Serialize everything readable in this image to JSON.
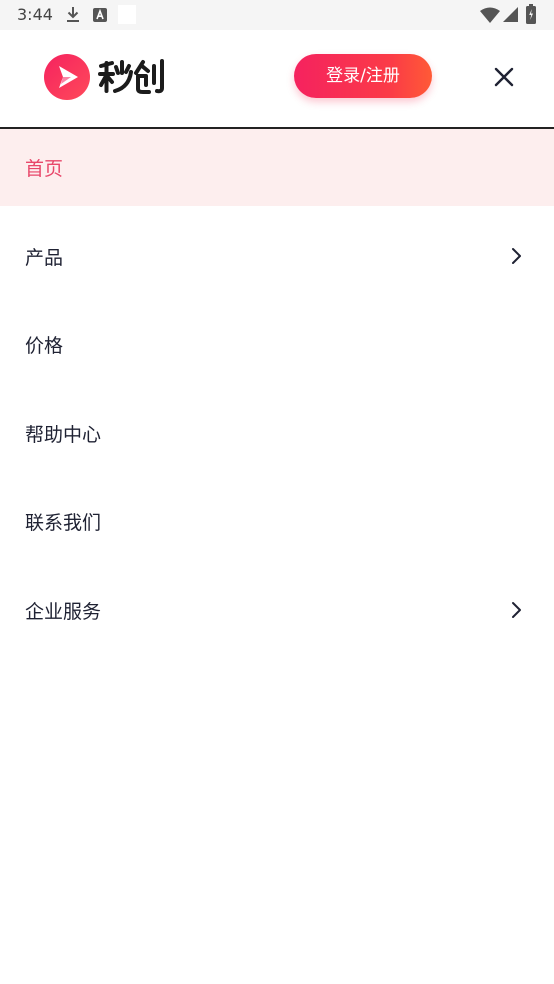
{
  "status_bar": {
    "time": "3:44",
    "icons": [
      "download-icon",
      "keyboard-a-icon",
      "blank-notification-icon",
      "wifi-icon",
      "signal-icon",
      "battery-icon"
    ]
  },
  "header": {
    "brand_name": "秒创",
    "login_label": "登录/注册",
    "brand_color": "#f12b5f",
    "button_gradient": [
      "#f5225f",
      "#ff5a36"
    ]
  },
  "menu": {
    "items": [
      {
        "label": "首页",
        "active": true,
        "has_chevron": false
      },
      {
        "label": "产品",
        "active": false,
        "has_chevron": true
      },
      {
        "label": "价格",
        "active": false,
        "has_chevron": false
      },
      {
        "label": "帮助中心",
        "active": false,
        "has_chevron": false
      },
      {
        "label": "联系我们",
        "active": false,
        "has_chevron": false
      },
      {
        "label": "企业服务",
        "active": false,
        "has_chevron": true
      }
    ],
    "active_color": "#e8476a",
    "active_bg": "#fdeeee"
  }
}
